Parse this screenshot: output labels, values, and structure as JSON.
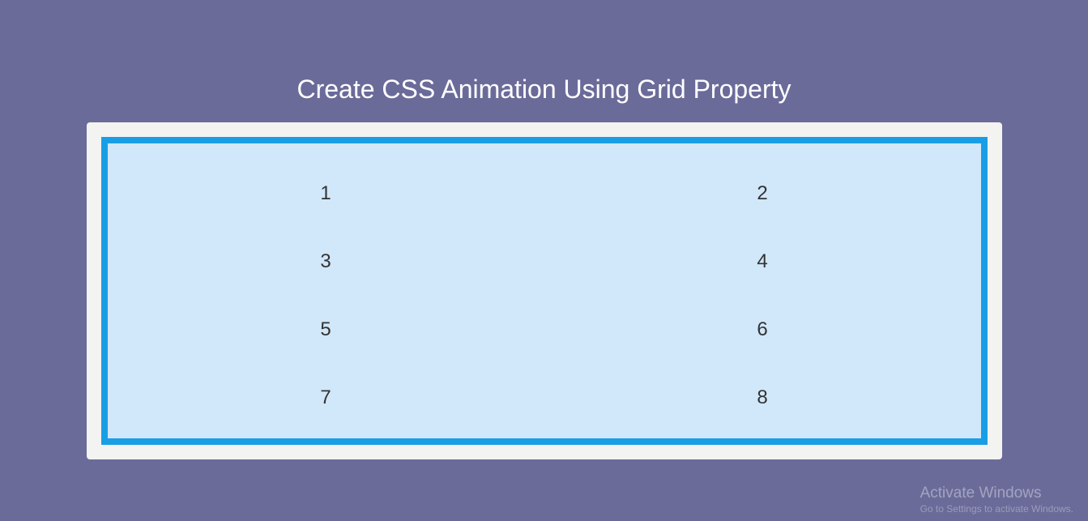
{
  "title": "Create CSS Animation Using Grid Property",
  "grid": {
    "cells": [
      "1",
      "2",
      "3",
      "4",
      "5",
      "6",
      "7",
      "8"
    ]
  },
  "watermark": {
    "title": "Activate Windows",
    "subtitle": "Go to Settings to activate Windows."
  },
  "colors": {
    "background": "#6b6b9a",
    "containerBg": "#f3f3f2",
    "gridBg": "#d1e7fa",
    "gridBorder": "#199ee5",
    "titleText": "#ffffff",
    "cellText": "#333333"
  }
}
